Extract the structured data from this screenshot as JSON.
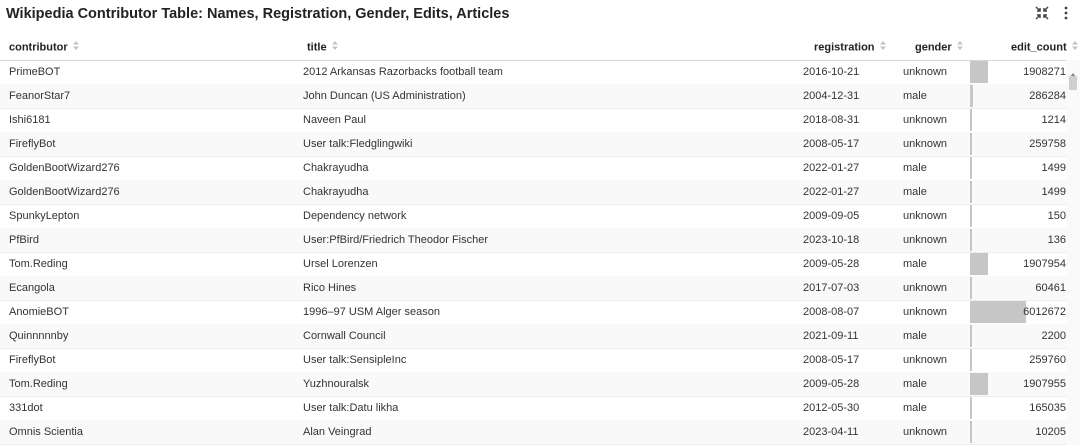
{
  "header": {
    "title": "Wikipedia Contributor Table: Names, Registration, Gender, Edits, Articles"
  },
  "icons": {
    "minimize": "minimize-icon",
    "menu": "more-vertical-icon",
    "sort": "sort-icon"
  },
  "table": {
    "columns": [
      {
        "key": "contributor",
        "label": "contributor"
      },
      {
        "key": "title",
        "label": "title"
      },
      {
        "key": "registration",
        "label": "registration"
      },
      {
        "key": "gender",
        "label": "gender"
      },
      {
        "key": "edit_count",
        "label": "edit_count"
      }
    ],
    "max_edit_count": 6012672,
    "rows": [
      {
        "contributor": "PrimeBOT",
        "title": "2012 Arkansas Razorbacks football team",
        "registration": "2016-10-21",
        "gender": "unknown",
        "edit_count": "1908271"
      },
      {
        "contributor": "FeanorStar7",
        "title": "John Duncan (US Administration)",
        "registration": "2004-12-31",
        "gender": "male",
        "edit_count": "286284"
      },
      {
        "contributor": "Ishi6181",
        "title": "Naveen Paul",
        "registration": "2018-08-31",
        "gender": "unknown",
        "edit_count": "1214"
      },
      {
        "contributor": "FireflyBot",
        "title": "User talk:Fledglingwiki",
        "registration": "2008-05-17",
        "gender": "unknown",
        "edit_count": "259758"
      },
      {
        "contributor": "GoldenBootWizard276",
        "title": "Chakrayudha",
        "registration": "2022-01-27",
        "gender": "male",
        "edit_count": "1499"
      },
      {
        "contributor": "GoldenBootWizard276",
        "title": "Chakrayudha",
        "registration": "2022-01-27",
        "gender": "male",
        "edit_count": "1499"
      },
      {
        "contributor": "SpunkyLepton",
        "title": "Dependency network",
        "registration": "2009-09-05",
        "gender": "unknown",
        "edit_count": "150"
      },
      {
        "contributor": "PfBird",
        "title": "User:PfBird/Friedrich Theodor Fischer",
        "registration": "2023-10-18",
        "gender": "unknown",
        "edit_count": "136"
      },
      {
        "contributor": "Tom.Reding",
        "title": "Ursel Lorenzen",
        "registration": "2009-05-28",
        "gender": "male",
        "edit_count": "1907954"
      },
      {
        "contributor": "Ecangola",
        "title": "Rico Hines",
        "registration": "2017-07-03",
        "gender": "unknown",
        "edit_count": "60461"
      },
      {
        "contributor": "AnomieBOT",
        "title": "1996–97 USM Alger season",
        "registration": "2008-08-07",
        "gender": "unknown",
        "edit_count": "6012672"
      },
      {
        "contributor": "Quinnnnnby",
        "title": "Cornwall Council",
        "registration": "2021-09-11",
        "gender": "male",
        "edit_count": "2200"
      },
      {
        "contributor": "FireflyBot",
        "title": "User talk:SensipleInc",
        "registration": "2008-05-17",
        "gender": "unknown",
        "edit_count": "259760"
      },
      {
        "contributor": "Tom.Reding",
        "title": "Yuzhnouralsk",
        "registration": "2009-05-28",
        "gender": "male",
        "edit_count": "1907955"
      },
      {
        "contributor": "331dot",
        "title": "User talk:Datu likha",
        "registration": "2012-05-30",
        "gender": "male",
        "edit_count": "165035"
      },
      {
        "contributor": "Omnis Scientia",
        "title": "Alan Veingrad",
        "registration": "2023-04-11",
        "gender": "unknown",
        "edit_count": "10205"
      }
    ]
  },
  "colors": {
    "bar": "#c6c6c6",
    "row_alt": "#f9f9f9",
    "border": "#ececec"
  }
}
